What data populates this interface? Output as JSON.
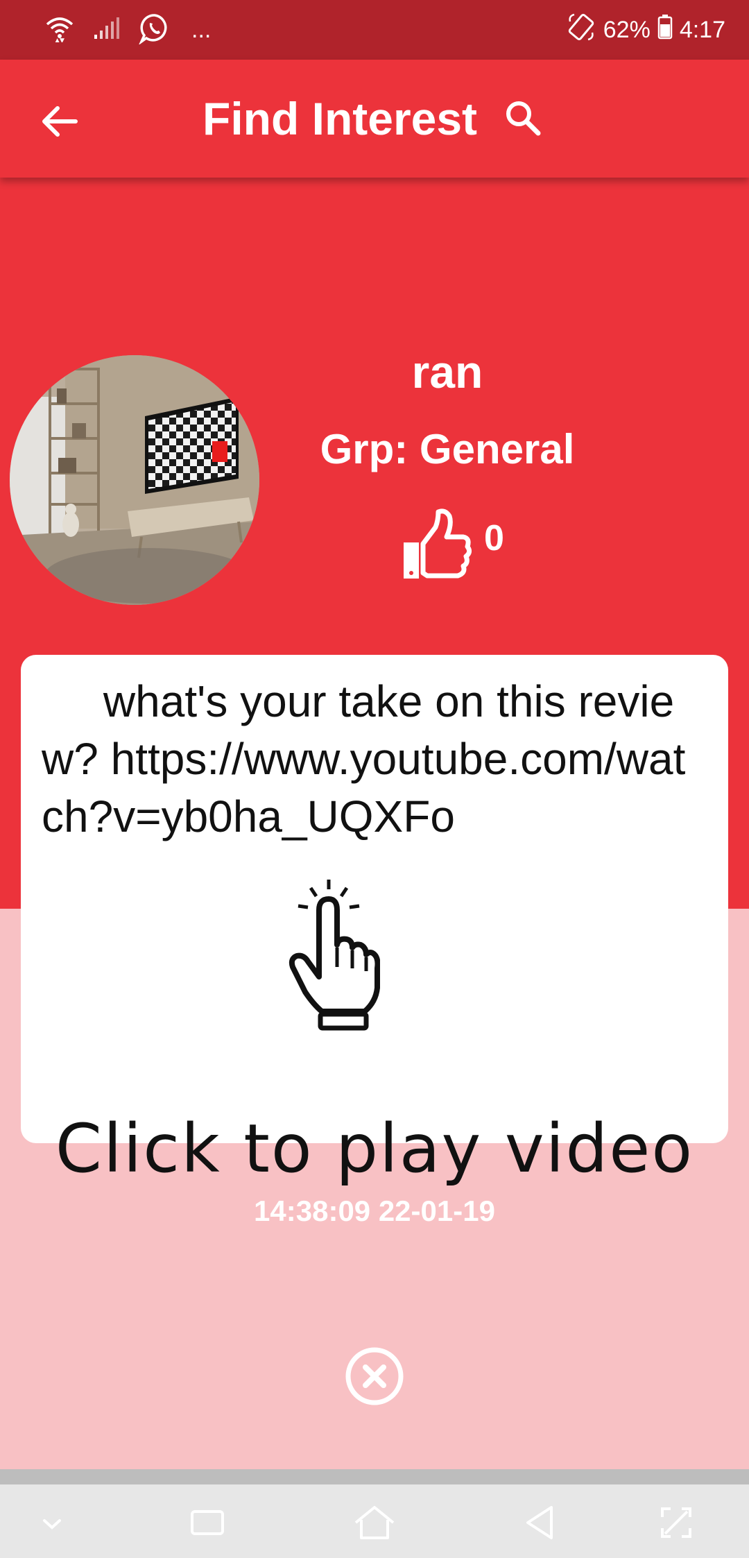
{
  "status_bar": {
    "battery": "62%",
    "time": "4:17",
    "more_indicator": "...",
    "icons": [
      "wifi-icon",
      "signal-icon",
      "whatsapp-icon",
      "rotate-icon",
      "battery-icon"
    ]
  },
  "app_bar": {
    "title": "Find Interest",
    "back_icon": "arrow-left-icon",
    "search_icon": "search-icon"
  },
  "profile": {
    "name": "ran",
    "group": "Grp: General",
    "likes": "0"
  },
  "post": {
    "text": "     what's your take on this review? https://www.youtube.com/watch?v=yb0ha_UQXFo",
    "play_hint": "Click to play video",
    "timestamp": "14:38:09 22-01-19"
  },
  "colors": {
    "status_bar": "#b0232b",
    "primary": "#ec333b",
    "background_light": "#f8c1c4",
    "card": "#ffffff"
  },
  "nav_bar": {
    "icons": [
      "chevron-down-icon",
      "recent-apps-icon",
      "home-icon",
      "back-triangle-icon",
      "expand-icon"
    ]
  }
}
